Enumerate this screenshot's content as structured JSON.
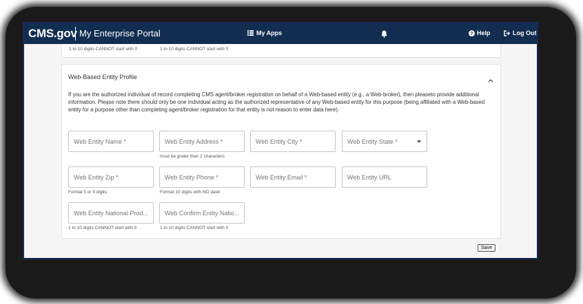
{
  "header": {
    "logo": "CMS.gov",
    "portal_name": "My Enterprise Portal",
    "my_apps": "My Apps",
    "help": "Help",
    "logout": "Log Out"
  },
  "top_hints": {
    "left": "1 to 10 digits CANNOT start with 0",
    "right": "1 to 10 digits CANNOT start with 0"
  },
  "section": {
    "title": "Web-Based Entity Profile",
    "description": "If you are the authorized individual of record completing CMS agent/broker registration on behalf of a Web-based entity (e.g., a Web-broker), then pleaseto provide additional information. Please note there should only be one individual acting as the authorized representative of any Web-based entity for this purpose (being affiliated with a Web-based entity for a purpose other than completing agent/broker registration for that entity is not reason to enter data here)."
  },
  "fields": {
    "entity_name": {
      "placeholder": "Web Entity Name *"
    },
    "entity_address": {
      "placeholder": "Web Entity Address *",
      "hint": "must be grater than 2 characters"
    },
    "entity_city": {
      "placeholder": "Web Entity City *"
    },
    "entity_state": {
      "placeholder": "Web Entity State *"
    },
    "entity_zip": {
      "placeholder": "Web Entity Zip *",
      "hint": "Format 5 or 9 digits"
    },
    "entity_phone": {
      "placeholder": "Web Entity Phone *",
      "hint": "Format 10 digits with NO dash"
    },
    "entity_email": {
      "placeholder": "Web Entity Email *"
    },
    "entity_url": {
      "placeholder": "Web Entity URL"
    },
    "entity_npn": {
      "placeholder": "Web Entity National Prod...",
      "hint": "1 to 10 digits CANNOT start with 0"
    },
    "entity_npn_confirm": {
      "placeholder": "Web Confirm Entity Natio...",
      "hint": "1 to 10 digits CANNOT start with 0"
    }
  },
  "actions": {
    "save": "Save"
  },
  "colors": {
    "header_bg": "#112e51",
    "frame_border": "#1c2a5a"
  }
}
